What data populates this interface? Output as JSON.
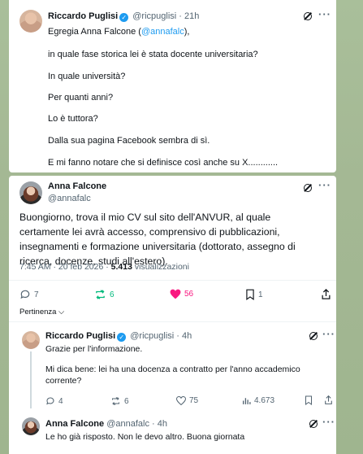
{
  "tweet1": {
    "name": "Riccardo Puglisi",
    "handle": "@ricpuglisi",
    "time": "21h",
    "lines": [
      "Egregia Anna Falcone (",
      "@annafalc",
      "),",
      "in quale fase storica lei è stata docente universitaria?",
      "In quale università?",
      "Per quanti anni?",
      "Lo è tuttora?",
      "Dalla sua pagina Facebook sembra di sì.",
      "E mi fanno notare che si definisce così anche su X............"
    ]
  },
  "main_tweet": {
    "name": "Anna Falcone",
    "handle": "@annafalc",
    "text": "Buongiorno, trova il mio CV sul sito dell'ANVUR, al quale certamente lei avrà accesso, comprensivo di pubblicazioni, insegnamenti e formazione universitaria (dottorato, assegno di ricerca, docenze, studi all'estero).",
    "timestamp": "7:45 AM · 20 feb 2026 · ",
    "views_count": "5.413",
    "views_label": " visualizzazioni",
    "replies": "7",
    "reposts": "6",
    "likes": "56",
    "bookmarks": "1",
    "sort_label": "Pertinenza"
  },
  "reply1": {
    "name": "Riccardo Puglisi",
    "handle": "@ricpuglisi",
    "time": "· 4h",
    "line1": "Grazie per l'informazione.",
    "line2": "Mi dica bene: lei ha una docenza a contratto per l'anno accademico",
    "line3": "corrente?",
    "replies": "4",
    "reposts": "6",
    "likes": "75",
    "views": "4.673"
  },
  "reply2": {
    "name": "Anna Falcone",
    "handle": "@annafalc",
    "time": "· 4h",
    "text": "Le ho già risposto. Non le devo altro. Buona giornata"
  },
  "colors": {
    "accent": "#1d9bf0",
    "retweet_green": "#00ba7c",
    "like_pink": "#f91880",
    "muted": "#536471",
    "background": "#a6bb96"
  }
}
